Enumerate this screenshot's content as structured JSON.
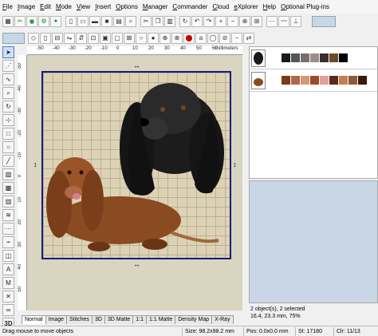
{
  "menu": [
    "File",
    "Image",
    "Edit",
    "Mode",
    "View",
    "Insert",
    "Options",
    "Manager",
    "Commander",
    "Cloud",
    "eXplorer",
    "Help",
    "Optional Plug-ins"
  ],
  "ruler": {
    "top_ticks": [
      "-50",
      "-40",
      "-30",
      "-20",
      "-10",
      "0",
      "10",
      "20",
      "30",
      "40",
      "50",
      "60"
    ],
    "top_unit": "millimeters",
    "left_ticks": [
      "-50",
      "-40",
      "-30",
      "-20",
      "-10",
      "0",
      "10",
      "20",
      "30",
      "40",
      "50"
    ]
  },
  "tabs": [
    "Normal",
    "Image",
    "Stitches",
    "3D",
    "3D Matte",
    "1:1",
    "1:1 Matte",
    "Density Map",
    "X-Ray"
  ],
  "palettes": [
    [
      "#1a1a1a",
      "#555555",
      "#7a6e6a",
      "#9a8f8c",
      "#3a2e2c",
      "#6b4a2a",
      "#000000"
    ],
    [
      "#7a3a1a",
      "#b0684a",
      "#d29a7a",
      "#a04a2a",
      "#e0a0a0",
      "#5a2a1a",
      "#c08050",
      "#8a5a3a",
      "#3a1a0a"
    ]
  ],
  "panel_info": {
    "objects": "2 object(s), 2 selected",
    "dims": "16.4, 23.3 mm, 75%"
  },
  "status": {
    "hint": "Drag mouse to move objects",
    "size": "Size: 98.2x98.2 mm",
    "pos": "Pos: 0.0x0.0 mm",
    "stitches": "St: 17180",
    "colors": "Clr: 11/13"
  }
}
